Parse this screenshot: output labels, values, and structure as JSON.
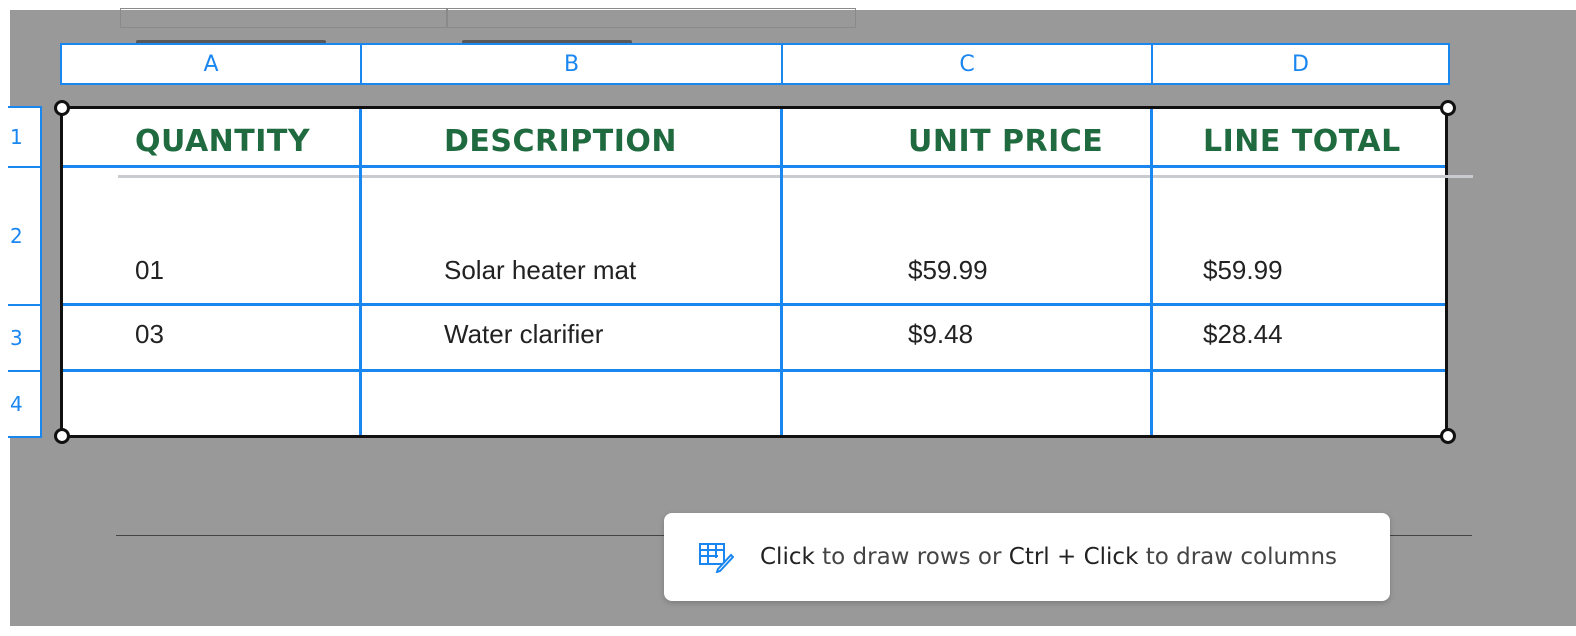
{
  "columns": [
    "A",
    "B",
    "C",
    "D"
  ],
  "rows": [
    "1",
    "2",
    "3",
    "4"
  ],
  "table": {
    "headers": [
      "QUANTITY",
      "DESCRIPTION",
      "UNIT PRICE",
      "LINE TOTAL"
    ],
    "data": [
      [
        "01",
        "Solar heater mat",
        "$59.99",
        "$59.99"
      ],
      [
        "03",
        "Water clarifier",
        "$9.48",
        "$28.44"
      ]
    ]
  },
  "tooltip": {
    "click": "Click",
    "to_draw_rows_or": " to draw rows or ",
    "ctrl_click": "Ctrl + Click",
    "to_draw_columns": " to draw columns"
  },
  "colors": {
    "accent": "#1a86f0",
    "header_text": "#1f6a3f",
    "backdrop": "#999999"
  },
  "icons": {
    "tooltip": "table-draw-icon"
  }
}
